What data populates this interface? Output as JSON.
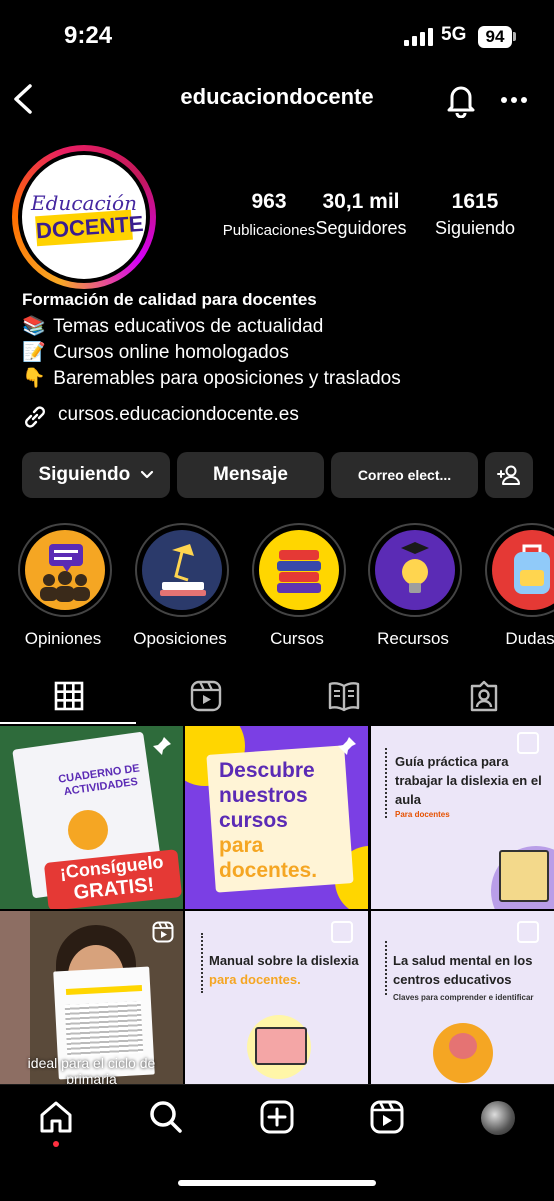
{
  "status": {
    "time": "9:24",
    "network": "5G",
    "battery": "94"
  },
  "header": {
    "username": "educaciondocente"
  },
  "profile": {
    "logo_top": "Educación",
    "logo_bottom": "DOCENTE",
    "stats": [
      {
        "value": "963",
        "label": "Publicaciones"
      },
      {
        "value": "30,1 mil",
        "label": "Seguidores"
      },
      {
        "value": "1615",
        "label": "Siguiendo"
      }
    ],
    "bio_title": "Formación de calidad para docentes",
    "bio_lines": [
      {
        "emoji": "📚",
        "text": "Temas educativos de actualidad"
      },
      {
        "emoji": "📝",
        "text": "Cursos online homologados"
      },
      {
        "emoji": "👇",
        "text": "Baremables para oposiciones y traslados"
      }
    ],
    "link": "cursos.educaciondocente.es"
  },
  "buttons": {
    "following": "Siguiendo",
    "message": "Mensaje",
    "email": "Correo elect..."
  },
  "highlights": [
    {
      "label": "Opiniones",
      "bg": "#f5a623",
      "icon": "speech-bubble-icon"
    },
    {
      "label": "Oposiciones",
      "bg": "#2b3a6b",
      "icon": "desk-lamp-icon"
    },
    {
      "label": "Cursos",
      "bg": "#ffd600",
      "icon": "stacked-books-icon"
    },
    {
      "label": "Recursos",
      "bg": "#5b2bb5",
      "icon": "lightbulb-icon"
    },
    {
      "label": "Dudas",
      "bg": "#e53935",
      "icon": "backpack-icon"
    }
  ],
  "posts": [
    {
      "lines": [
        "CUADERNO DE",
        "ACTIVIDADES"
      ],
      "banner": [
        "¡Consíguelo",
        "GRATIS!"
      ],
      "pinned": true
    },
    {
      "lines": [
        "Descubre",
        "nuestros",
        "cursos",
        "para",
        "docentes."
      ],
      "pinned": true
    },
    {
      "lines": [
        "Guía práctica para",
        "trabajar la dislexia en el",
        "aula"
      ],
      "sub": "Para docentes"
    },
    {
      "caption": [
        "ideal para el ciclo de",
        "primaria"
      ],
      "reel": true
    },
    {
      "lines": [
        "Manual sobre la dislexia",
        "para docentes."
      ]
    },
    {
      "lines": [
        "La salud mental en los",
        "centros educativos"
      ],
      "sub": "Claves para comprender e identificar"
    }
  ]
}
